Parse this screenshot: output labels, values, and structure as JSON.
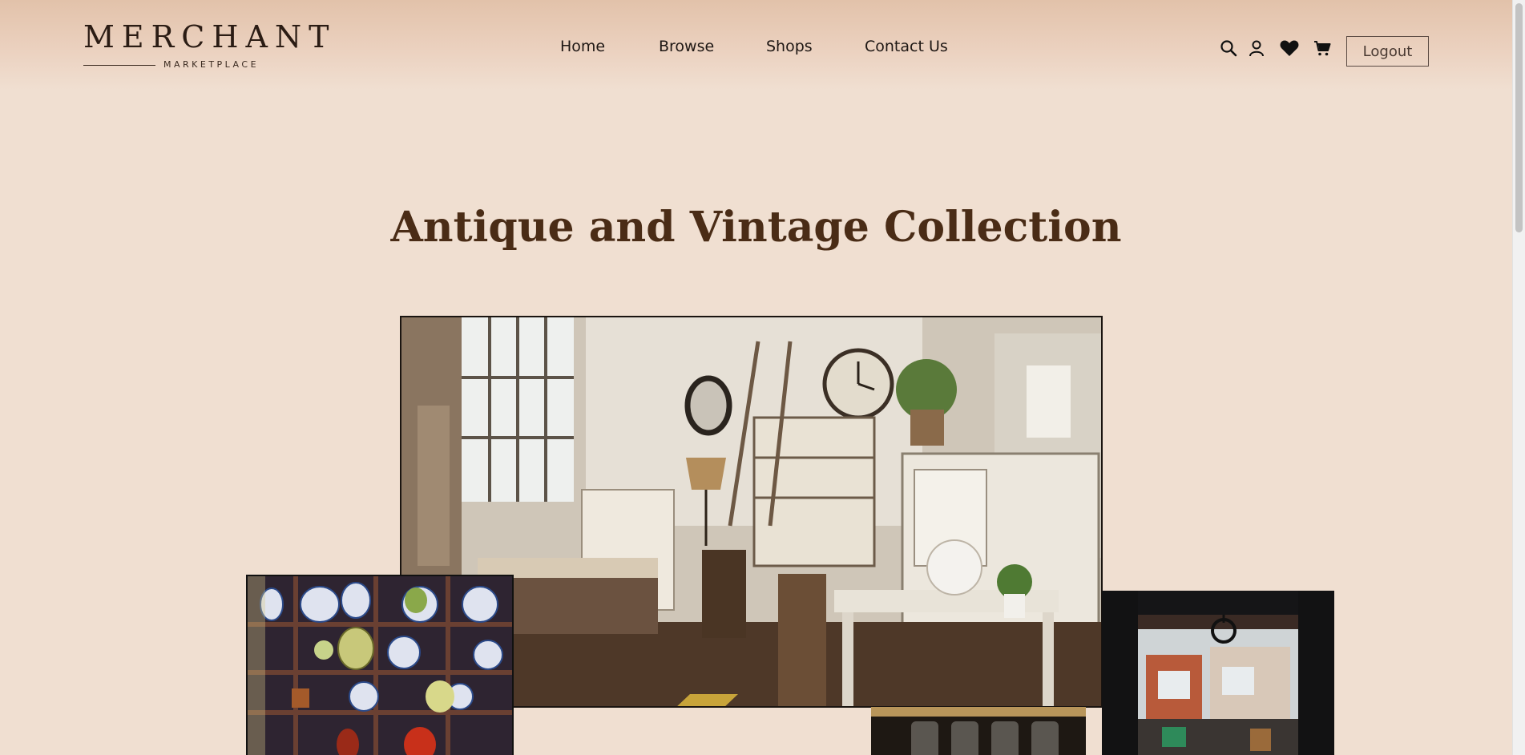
{
  "header": {
    "logo": {
      "word": "MERCHANT",
      "sub": "MARKETPLACE"
    },
    "nav": [
      {
        "label": "Home"
      },
      {
        "label": "Browse"
      },
      {
        "label": "Shops"
      },
      {
        "label": "Contact Us"
      }
    ],
    "icons": [
      "search-icon",
      "user-icon",
      "heart-icon",
      "cart-icon"
    ],
    "logout_label": "Logout"
  },
  "hero": {
    "title": "Antique and Vintage Collection"
  },
  "colors": {
    "background": "#f0dfd1",
    "header_top": "#e2c2aa",
    "title": "#4a2c16",
    "nav_text": "#1e1714"
  }
}
